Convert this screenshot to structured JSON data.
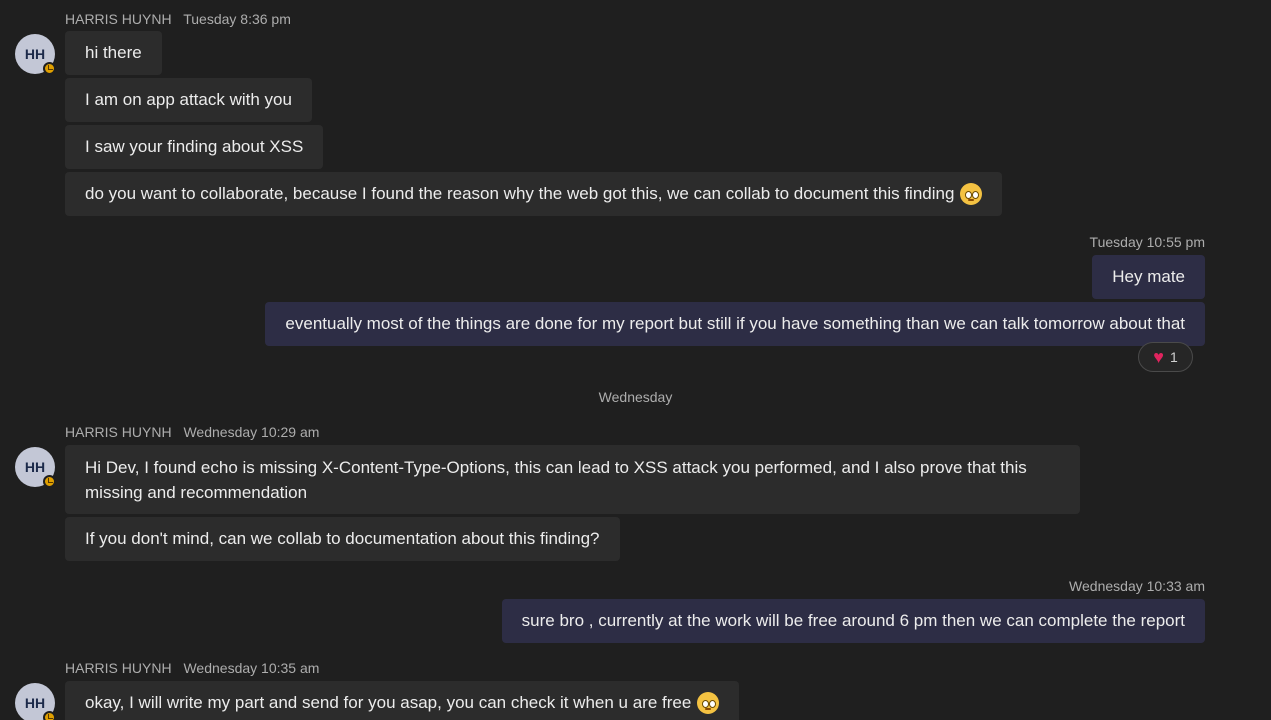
{
  "messages": {
    "group1": {
      "sender": "HARRIS HUYNH",
      "time": "Tuesday 8:36 pm",
      "avatar_initials": "HH",
      "lines": [
        "hi there",
        "I am on app attack with you",
        "I saw your finding about XSS",
        "do you want to collaborate, because I found the reason why the web got this, we can collab to document this finding"
      ]
    },
    "group2": {
      "time": "Tuesday 10:55 pm",
      "lines": [
        "Hey mate",
        "eventually most of the things are done for my report but still if you have something than we can talk tomorrow about that"
      ],
      "reaction": {
        "icon": "heart-icon",
        "count": "1"
      }
    },
    "day_separator": "Wednesday",
    "group3": {
      "sender": "HARRIS HUYNH",
      "time": "Wednesday 10:29 am",
      "avatar_initials": "HH",
      "lines": [
        "Hi Dev, I found echo is missing X-Content-Type-Options, this can lead to XSS attack you performed, and I also prove that this missing and recommendation",
        "If you don't mind, can we collab to documentation about this finding?"
      ]
    },
    "group4": {
      "time": "Wednesday 10:33 am",
      "lines": [
        "sure bro , currently at the work will be free around 6 pm then we can complete the report"
      ]
    },
    "group5": {
      "sender": "HARRIS HUYNH",
      "time": "Wednesday 10:35 am",
      "avatar_initials": "HH",
      "lines": [
        "okay, I will write my part and send for you asap, you can check it when u are free"
      ]
    }
  },
  "colors": {
    "background": "#1f1f1f",
    "incoming_bubble": "#2c2c2c",
    "outgoing_bubble": "#2d2d45",
    "away_status": "#e0a000"
  }
}
